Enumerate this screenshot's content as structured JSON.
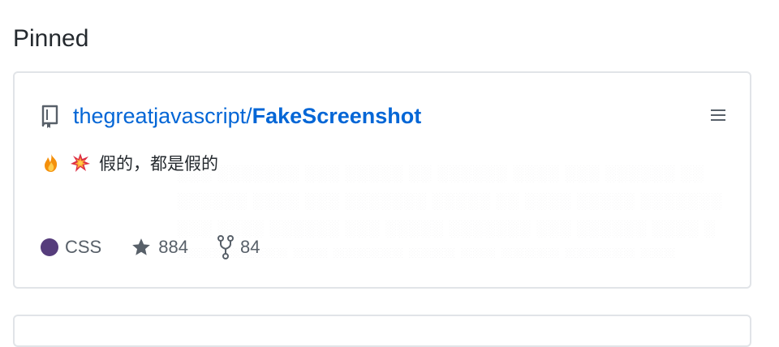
{
  "section": {
    "title": "Pinned"
  },
  "pinned_repo": {
    "owner": "thegreatjavascript",
    "separator": "/",
    "name": "FakeScreenshot",
    "description": "假的，都是假的",
    "emoji": [
      "fire-emoji",
      "collision-emoji"
    ],
    "language": {
      "name": "CSS",
      "color": "#563d7c"
    },
    "stars": "884",
    "forks": "84"
  },
  "colors": {
    "link": "#0366d6",
    "muted": "#586069",
    "border": "#e1e4e8"
  }
}
